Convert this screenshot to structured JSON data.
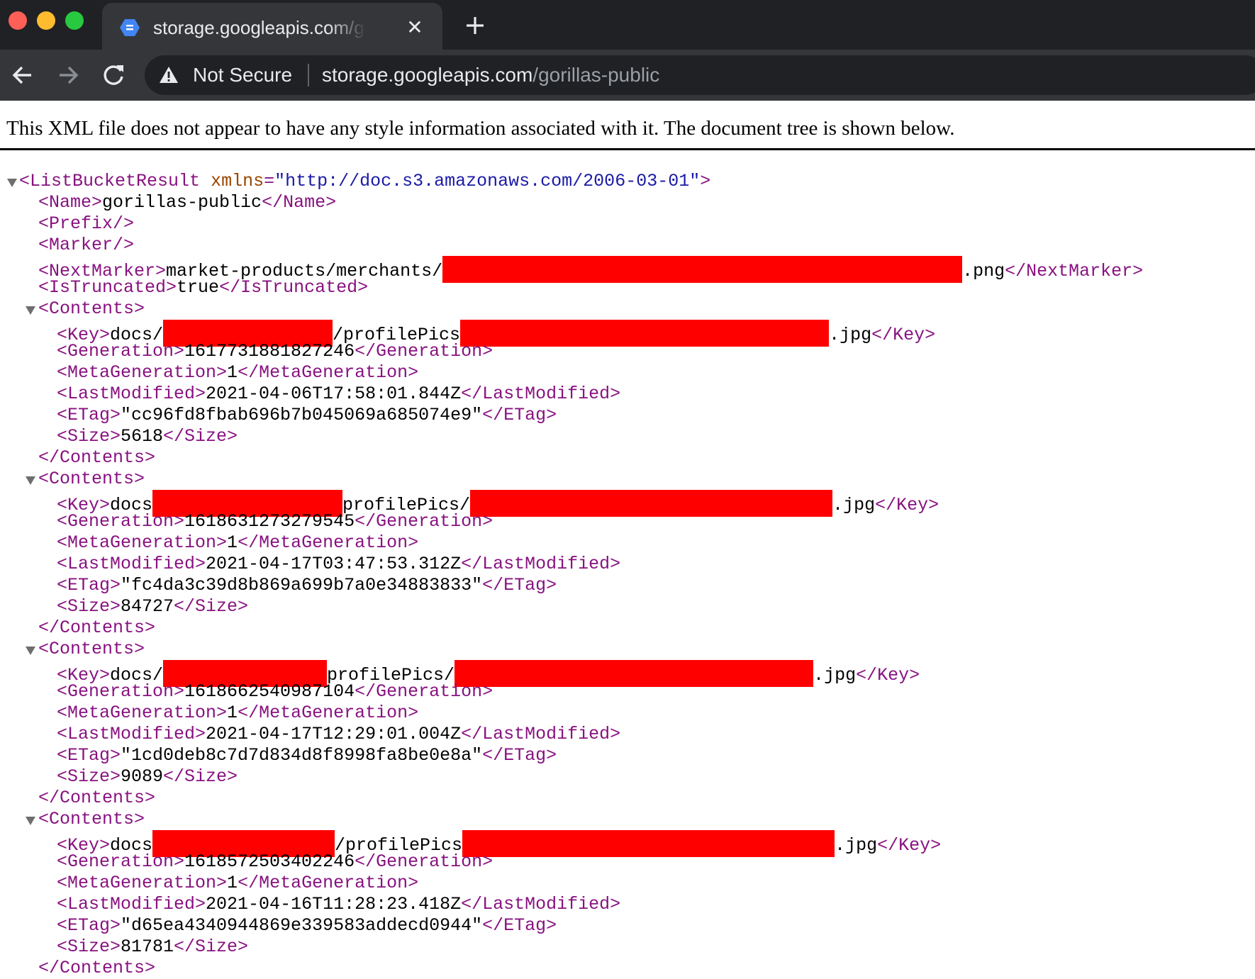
{
  "browser": {
    "tab_title": "storage.googleapis.com/gorillas-public",
    "tab_close": "✕",
    "security_label": "Not Secure",
    "url_host": "storage.googleapis.com",
    "url_path": "/gorillas-public"
  },
  "notice": "This XML file does not appear to have any style information associated with it. The document tree is shown below.",
  "xml": {
    "root_tag": "ListBucketResult",
    "root_attr_name": "xmlns",
    "root_attr_value": "\"http://doc.s3.amazonaws.com/2006-03-01\"",
    "name": "gorillas-public",
    "next_marker_prefix": "market-products/merchants/",
    "next_marker_suffix": ".png",
    "is_truncated": "true",
    "contents": [
      {
        "key_prefix": "docs/",
        "key_mid": "/profilePics",
        "key_suffix": ".jpg",
        "generation": "1617731881827246",
        "meta_generation": "1",
        "last_modified": "2021-04-06T17:58:01.844Z",
        "etag": "\"cc96fd8fbab696b7b045069a685074e9\"",
        "size": "5618"
      },
      {
        "key_prefix": "docs",
        "key_mid": "profilePics/",
        "key_suffix": ".jpg",
        "generation": "1618631273279545",
        "meta_generation": "1",
        "last_modified": "2021-04-17T03:47:53.312Z",
        "etag": "\"fc4da3c39d8b869a699b7a0e34883833\"",
        "size": "84727"
      },
      {
        "key_prefix": "docs/",
        "key_mid": "profilePics/",
        "key_suffix": ".jpg",
        "generation": "1618662540987104",
        "meta_generation": "1",
        "last_modified": "2021-04-17T12:29:01.004Z",
        "etag": "\"1cd0deb8c7d7d834d8f8998fa8be0e8a\"",
        "size": "9089"
      },
      {
        "key_prefix": "docs",
        "key_mid": "/profilePics",
        "key_suffix": ".jpg",
        "generation": "1618572503402246",
        "meta_generation": "1",
        "last_modified": "2021-04-16T11:28:23.418Z",
        "etag": "\"d65ea4340944869e339583addecd0944\"",
        "size": "81781"
      }
    ]
  },
  "colors": {
    "tag": "#881280",
    "attr_name": "#994500",
    "attr_value": "#1a1aa6",
    "redaction": "#ff0000"
  }
}
